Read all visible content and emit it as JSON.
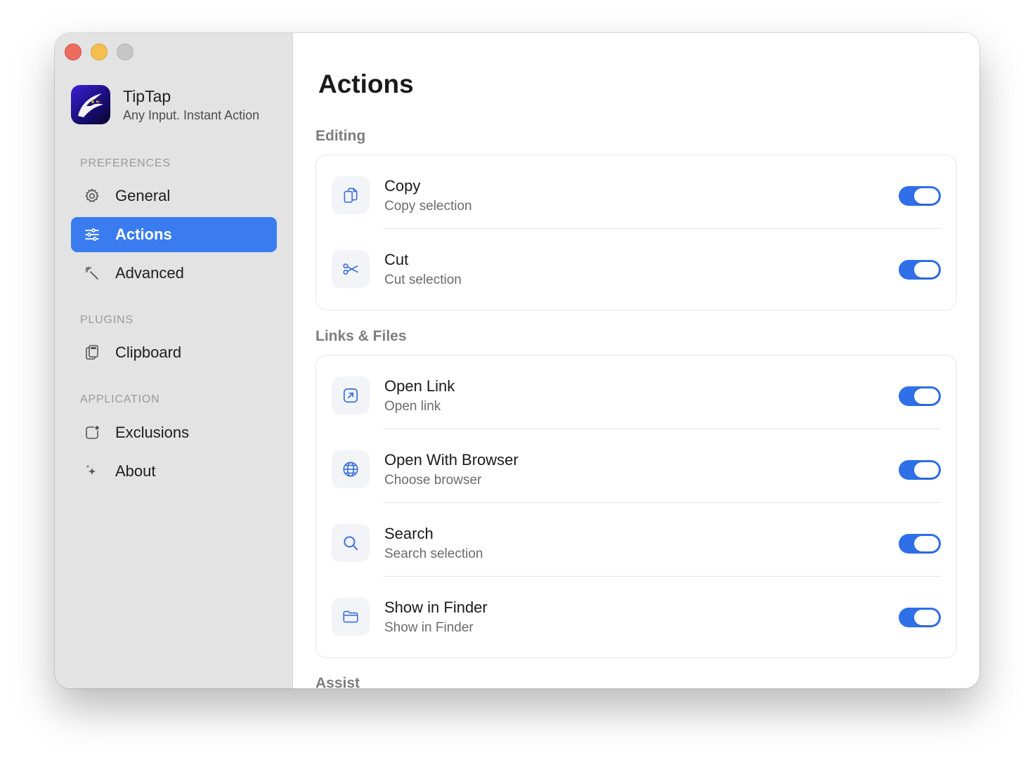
{
  "app": {
    "name": "TipTap",
    "tagline": "Any Input. Instant Action"
  },
  "sidebar": {
    "sections": [
      {
        "label": "PREFERENCES",
        "items": [
          {
            "label": "General",
            "icon": "gear-icon"
          },
          {
            "label": "Actions",
            "icon": "sliders-icon",
            "selected": true
          },
          {
            "label": "Advanced",
            "icon": "magic-wand-icon"
          }
        ]
      },
      {
        "label": "PLUGINS",
        "items": [
          {
            "label": "Clipboard",
            "icon": "clipboard-icon"
          }
        ]
      },
      {
        "label": "APPLICATION",
        "items": [
          {
            "label": "Exclusions",
            "icon": "app-badge-icon"
          },
          {
            "label": "About",
            "icon": "sparkles-icon"
          }
        ]
      }
    ]
  },
  "main": {
    "title": "Actions",
    "groups": [
      {
        "label": "Editing",
        "rows": [
          {
            "title": "Copy",
            "subtitle": "Copy selection",
            "icon": "copy-icon",
            "enabled": true
          },
          {
            "title": "Cut",
            "subtitle": "Cut selection",
            "icon": "scissors-icon",
            "enabled": true
          }
        ]
      },
      {
        "label": "Links & Files",
        "rows": [
          {
            "title": "Open Link",
            "subtitle": "Open link",
            "icon": "open-link-icon",
            "enabled": true
          },
          {
            "title": "Open With Browser",
            "subtitle": "Choose browser",
            "icon": "globe-icon",
            "enabled": true
          },
          {
            "title": "Search",
            "subtitle": "Search selection",
            "icon": "search-icon",
            "enabled": true
          },
          {
            "title": "Show in Finder",
            "subtitle": "Show in Finder",
            "icon": "folder-icon",
            "enabled": true
          }
        ]
      },
      {
        "label": "Assist",
        "rows": []
      }
    ]
  },
  "colors": {
    "accent": "#3a7cf0",
    "toggle_on": "#2f6fe8",
    "sidebar_bg": "#e3e3e3"
  }
}
